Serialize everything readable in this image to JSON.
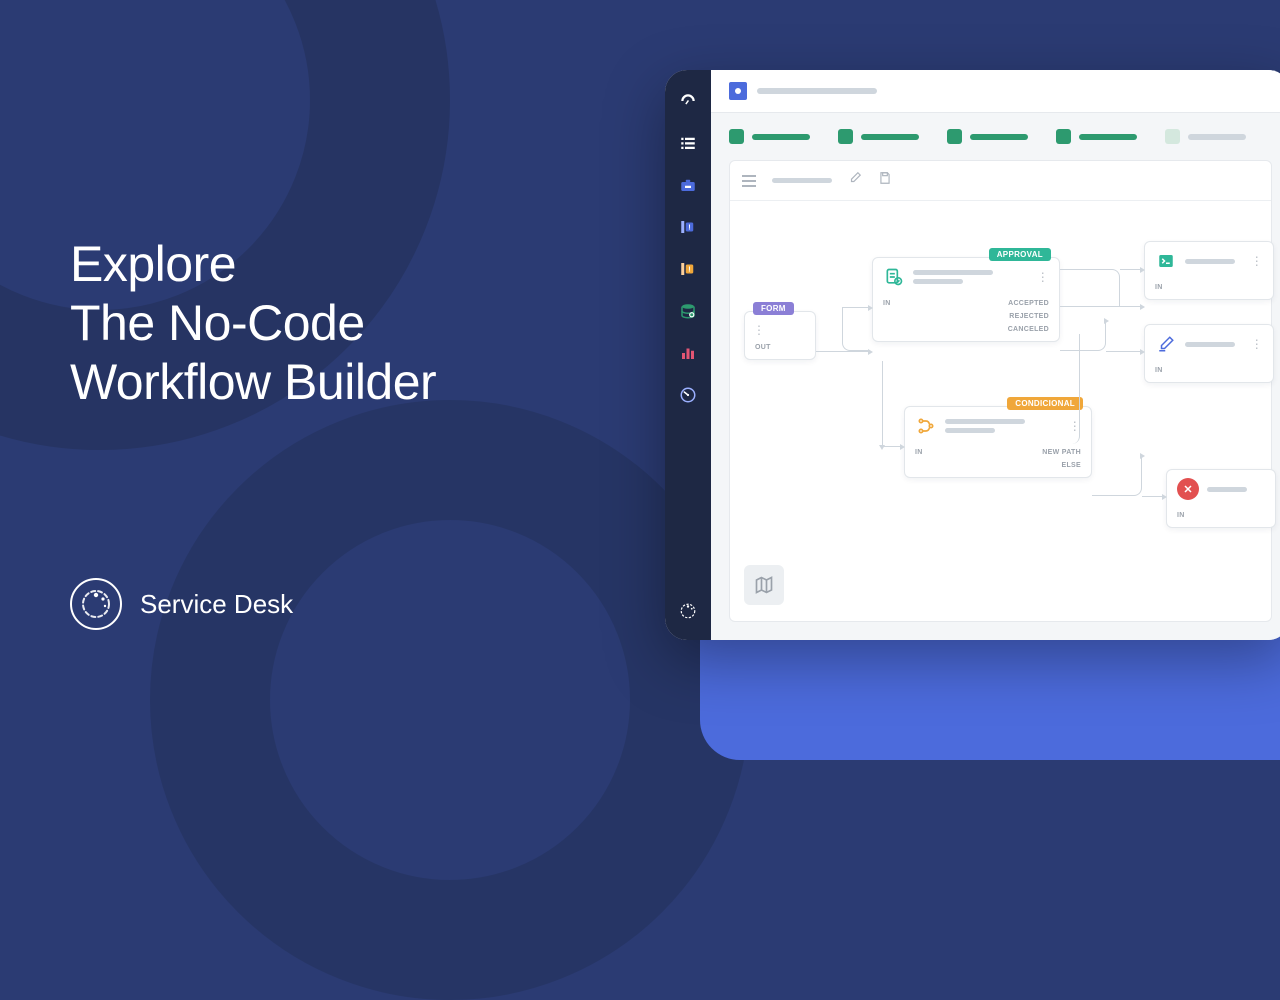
{
  "headline": {
    "line1": "Explore",
    "line2": "The No-Code",
    "line3": "Workflow Builder"
  },
  "brand": {
    "name": "Service Desk"
  },
  "sidebar": {
    "items": [
      {
        "id": "dashboard-icon"
      },
      {
        "id": "list-icon"
      },
      {
        "id": "briefcase-icon"
      },
      {
        "id": "priority-blue-icon"
      },
      {
        "id": "priority-orange-icon"
      },
      {
        "id": "database-icon"
      },
      {
        "id": "chart-icon"
      },
      {
        "id": "gauge-icon"
      }
    ]
  },
  "workflow": {
    "nodes": {
      "form": {
        "tag": "FORM",
        "ports": {
          "in": "",
          "out": "OUT"
        }
      },
      "approval": {
        "tag": "APPROVAL",
        "ports": {
          "in": "IN",
          "out1": "ACCEPTED",
          "out2": "REJECTED",
          "out3": "CANCELED"
        }
      },
      "conditional": {
        "tag": "CONDICIONAL",
        "ports": {
          "in": "IN",
          "out1": "NEW PATH",
          "out2": "ELSE"
        }
      },
      "script": {
        "ports": {
          "in": "IN"
        }
      },
      "edit": {
        "ports": {
          "in": "IN"
        }
      },
      "error": {
        "ports": {
          "in": "IN"
        }
      }
    }
  }
}
